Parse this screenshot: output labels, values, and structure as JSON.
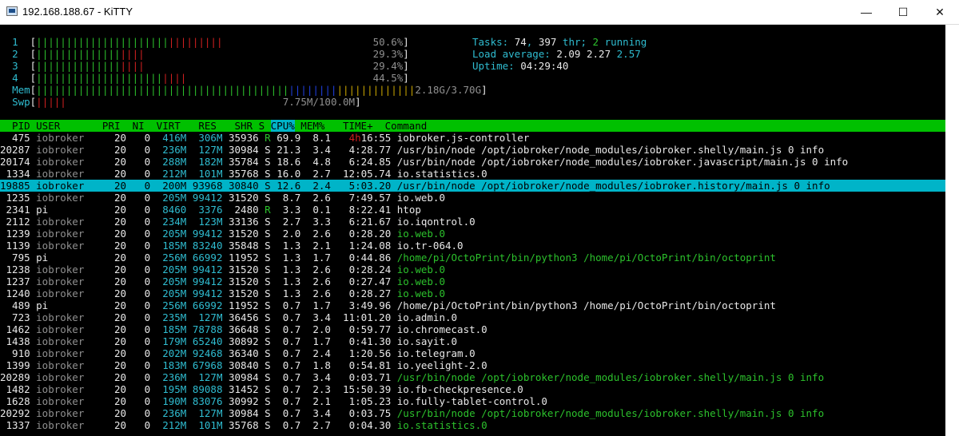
{
  "window": {
    "title": "192.168.188.67 - KiTTY",
    "minimize": "—",
    "maximize": "☐",
    "close": "✕"
  },
  "meters": [
    {
      "id": "1",
      "green": "||||||||||||||||||||||",
      "red": "|||||||||",
      "value": "50.6%"
    },
    {
      "id": "2",
      "green": "||||||||||||||",
      "red": "||||",
      "value": "29.3%"
    },
    {
      "id": "3",
      "green": "||||||||||||||",
      "red": "||||",
      "value": "29.4%"
    },
    {
      "id": "4",
      "green": "|||||||||||||||||||||",
      "red": "||||",
      "value": "44.5%"
    }
  ],
  "mem": {
    "label": "Mem",
    "green": "||||||||||||||||||||||||||||||||||||||||||",
    "blue": "||||||||",
    "yellow": "|||||||||||||",
    "value": "2.18G/3.70G"
  },
  "swp": {
    "label": "Swp",
    "red": "|||||",
    "value": "7.75M/100.0M"
  },
  "summary": {
    "tasks_label": "Tasks: ",
    "tasks": "74",
    "thr_sep": ", ",
    "thr": "397",
    "thr_label": " thr; ",
    "running": "2",
    "running_label": " running",
    "load_label": "Load average: ",
    "load1": "2.09",
    "load5": "2.27",
    "load15": "2.57",
    "uptime_label": "Uptime: ",
    "uptime": "04:29:40"
  },
  "header": "  PID USER       PRI  NI  VIRT   RES   SHR S ",
  "header_cpu": "CPU%",
  "header_rest": " MEM%   TIME+  Command",
  "processes": [
    {
      "pid": "475",
      "user": "iobroker",
      "pri": "20",
      "ni": "0",
      "virt": "416M",
      "res": "306M",
      "shr": "35936",
      "s": "R",
      "cpu": "69.9",
      "mem": "8.1",
      "time_h": "4h",
      "time": "16:55",
      "cmd": "iobroker.js-controller",
      "cmd_color": "wh"
    },
    {
      "pid": "20287",
      "user": "iobroker",
      "pri": "20",
      "ni": "0",
      "virt": "236M",
      "res": "127M",
      "shr": "30984",
      "s": "S",
      "cpu": "21.3",
      "mem": "3.4",
      "time_h": "",
      "time": "4:28.77",
      "cmd": "/usr/bin/node /opt/iobroker/node_modules/iobroker.shelly/main.js 0 info",
      "cmd_color": "wh"
    },
    {
      "pid": "20174",
      "user": "iobroker",
      "pri": "20",
      "ni": "0",
      "virt": "288M",
      "res": "182M",
      "shr": "35784",
      "s": "S",
      "cpu": "18.6",
      "mem": "4.8",
      "time_h": "",
      "time": "6:24.85",
      "cmd": "/usr/bin/node /opt/iobroker/node_modules/iobroker.javascript/main.js 0 info",
      "cmd_color": "wh"
    },
    {
      "pid": "1334",
      "user": "iobroker",
      "pri": "20",
      "ni": "0",
      "virt": "212M",
      "res": "101M",
      "shr": "35768",
      "s": "S",
      "cpu": "16.0",
      "mem": "2.7",
      "time_h": "",
      "time": "12:05.74",
      "cmd": "io.statistics.0",
      "cmd_color": "wh"
    },
    {
      "pid": "19885",
      "user": "iobroker",
      "pri": "20",
      "ni": "0",
      "virt": "200M",
      "res": "93968",
      "shr": "30840",
      "s": "S",
      "cpu": "12.6",
      "mem": "2.4",
      "time_h": "",
      "time": "5:03.20",
      "cmd": "/usr/bin/node /opt/iobroker/node_modules/iobroker.history/main.js 0 info",
      "cmd_color": "wh",
      "selected": true
    },
    {
      "pid": "1235",
      "user": "iobroker",
      "pri": "20",
      "ni": "0",
      "virt": "205M",
      "res": "99412",
      "shr": "31520",
      "s": "S",
      "cpu": "8.7",
      "mem": "2.6",
      "time_h": "",
      "time": "7:49.57",
      "cmd": "io.web.0",
      "cmd_color": "wh"
    },
    {
      "pid": "2341",
      "user": "pi",
      "pri": "20",
      "ni": "0",
      "virt": "8460",
      "res": "3376",
      "shr": "2480",
      "s": "R",
      "cpu": "3.3",
      "mem": "0.1",
      "time_h": "",
      "time": "8:22.41",
      "cmd": "htop",
      "cmd_color": "wh"
    },
    {
      "pid": "2112",
      "user": "iobroker",
      "pri": "20",
      "ni": "0",
      "virt": "234M",
      "res": "123M",
      "shr": "33136",
      "s": "S",
      "cpu": "2.7",
      "mem": "3.3",
      "time_h": "",
      "time": "6:21.67",
      "cmd": "io.iqontrol.0",
      "cmd_color": "wh"
    },
    {
      "pid": "1239",
      "user": "iobroker",
      "pri": "20",
      "ni": "0",
      "virt": "205M",
      "res": "99412",
      "shr": "31520",
      "s": "S",
      "cpu": "2.0",
      "mem": "2.6",
      "time_h": "",
      "time": "0:28.20",
      "cmd": "io.web.0",
      "cmd_color": "gr"
    },
    {
      "pid": "1139",
      "user": "iobroker",
      "pri": "20",
      "ni": "0",
      "virt": "185M",
      "res": "83240",
      "shr": "35848",
      "s": "S",
      "cpu": "1.3",
      "mem": "2.1",
      "time_h": "",
      "time": "1:24.08",
      "cmd": "io.tr-064.0",
      "cmd_color": "wh"
    },
    {
      "pid": "795",
      "user": "pi",
      "pri": "20",
      "ni": "0",
      "virt": "256M",
      "res": "66992",
      "shr": "11952",
      "s": "S",
      "cpu": "1.3",
      "mem": "1.7",
      "time_h": "",
      "time": "0:44.86",
      "cmd": "/home/pi/OctoPrint/bin/python3 /home/pi/OctoPrint/bin/octoprint",
      "cmd_color": "gr"
    },
    {
      "pid": "1238",
      "user": "iobroker",
      "pri": "20",
      "ni": "0",
      "virt": "205M",
      "res": "99412",
      "shr": "31520",
      "s": "S",
      "cpu": "1.3",
      "mem": "2.6",
      "time_h": "",
      "time": "0:28.24",
      "cmd": "io.web.0",
      "cmd_color": "gr"
    },
    {
      "pid": "1237",
      "user": "iobroker",
      "pri": "20",
      "ni": "0",
      "virt": "205M",
      "res": "99412",
      "shr": "31520",
      "s": "S",
      "cpu": "1.3",
      "mem": "2.6",
      "time_h": "",
      "time": "0:27.47",
      "cmd": "io.web.0",
      "cmd_color": "gr"
    },
    {
      "pid": "1240",
      "user": "iobroker",
      "pri": "20",
      "ni": "0",
      "virt": "205M",
      "res": "99412",
      "shr": "31520",
      "s": "S",
      "cpu": "1.3",
      "mem": "2.6",
      "time_h": "",
      "time": "0:28.27",
      "cmd": "io.web.0",
      "cmd_color": "gr"
    },
    {
      "pid": "489",
      "user": "pi",
      "pri": "20",
      "ni": "0",
      "virt": "256M",
      "res": "66992",
      "shr": "11952",
      "s": "S",
      "cpu": "0.7",
      "mem": "1.7",
      "time_h": "",
      "time": "3:49.96",
      "cmd": "/home/pi/OctoPrint/bin/python3 /home/pi/OctoPrint/bin/octoprint",
      "cmd_color": "wh"
    },
    {
      "pid": "723",
      "user": "iobroker",
      "pri": "20",
      "ni": "0",
      "virt": "235M",
      "res": "127M",
      "shr": "36456",
      "s": "S",
      "cpu": "0.7",
      "mem": "3.4",
      "time_h": "",
      "time": "11:01.20",
      "cmd": "io.admin.0",
      "cmd_color": "wh"
    },
    {
      "pid": "1462",
      "user": "iobroker",
      "pri": "20",
      "ni": "0",
      "virt": "185M",
      "res": "78788",
      "shr": "36648",
      "s": "S",
      "cpu": "0.7",
      "mem": "2.0",
      "time_h": "",
      "time": "0:59.77",
      "cmd": "io.chromecast.0",
      "cmd_color": "wh"
    },
    {
      "pid": "1438",
      "user": "iobroker",
      "pri": "20",
      "ni": "0",
      "virt": "179M",
      "res": "65240",
      "shr": "30892",
      "s": "S",
      "cpu": "0.7",
      "mem": "1.7",
      "time_h": "",
      "time": "0:41.30",
      "cmd": "io.sayit.0",
      "cmd_color": "wh"
    },
    {
      "pid": "910",
      "user": "iobroker",
      "pri": "20",
      "ni": "0",
      "virt": "202M",
      "res": "92468",
      "shr": "36340",
      "s": "S",
      "cpu": "0.7",
      "mem": "2.4",
      "time_h": "",
      "time": "1:20.56",
      "cmd": "io.telegram.0",
      "cmd_color": "wh"
    },
    {
      "pid": "1399",
      "user": "iobroker",
      "pri": "20",
      "ni": "0",
      "virt": "183M",
      "res": "67968",
      "shr": "30840",
      "s": "S",
      "cpu": "0.7",
      "mem": "1.8",
      "time_h": "",
      "time": "0:54.81",
      "cmd": "io.yeelight-2.0",
      "cmd_color": "wh"
    },
    {
      "pid": "20289",
      "user": "iobroker",
      "pri": "20",
      "ni": "0",
      "virt": "236M",
      "res": "127M",
      "shr": "30984",
      "s": "S",
      "cpu": "0.7",
      "mem": "3.4",
      "time_h": "",
      "time": "0:03.71",
      "cmd": "/usr/bin/node /opt/iobroker/node_modules/iobroker.shelly/main.js 0 info",
      "cmd_color": "gr"
    },
    {
      "pid": "1482",
      "user": "iobroker",
      "pri": "20",
      "ni": "0",
      "virt": "195M",
      "res": "89088",
      "shr": "31452",
      "s": "S",
      "cpu": "0.7",
      "mem": "2.3",
      "time_h": "",
      "time": "15:50.39",
      "cmd": "io.fb-checkpresence.0",
      "cmd_color": "wh"
    },
    {
      "pid": "1628",
      "user": "iobroker",
      "pri": "20",
      "ni": "0",
      "virt": "190M",
      "res": "83076",
      "shr": "30992",
      "s": "S",
      "cpu": "0.7",
      "mem": "2.1",
      "time_h": "",
      "time": "1:05.23",
      "cmd": "io.fully-tablet-control.0",
      "cmd_color": "wh"
    },
    {
      "pid": "20292",
      "user": "iobroker",
      "pri": "20",
      "ni": "0",
      "virt": "236M",
      "res": "127M",
      "shr": "30984",
      "s": "S",
      "cpu": "0.7",
      "mem": "3.4",
      "time_h": "",
      "time": "0:03.75",
      "cmd": "/usr/bin/node /opt/iobroker/node_modules/iobroker.shelly/main.js 0 info",
      "cmd_color": "gr"
    },
    {
      "pid": "1337",
      "user": "iobroker",
      "pri": "20",
      "ni": "0",
      "virt": "212M",
      "res": "101M",
      "shr": "35768",
      "s": "S",
      "cpu": "0.7",
      "mem": "2.7",
      "time_h": "",
      "time": "0:04.30",
      "cmd": "io.statistics.0",
      "cmd_color": "gr"
    }
  ]
}
